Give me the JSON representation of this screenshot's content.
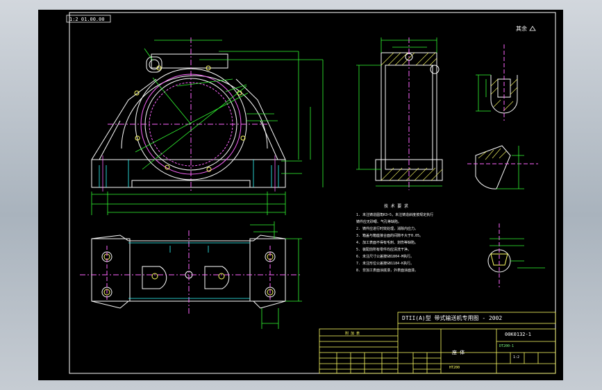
{
  "drawing": {
    "scale_box": "1:2 01.00.00",
    "corner_mark": "其余",
    "tech_title": "技 术 要 求",
    "tech_lines": [
      "1. 未注铸造圆角R3~5，未注铸造斜度按规定执行",
      "   铸件应无砂眼、气孔等缺陷。",
      "2. 铸件应进行时效处理，消除内应力。",
      "3. 箱盖与箱座接合面的间隙不大于0.05。",
      "4. 加工表面不得有毛刺、划伤等缺陷。",
      "5. 装配前所有零件均应清洗干净。",
      "6. 未注尺寸公差按GB1804-M执行。",
      "7. 未注形位公差按GB1184-K执行。",
      "8. 非加工表面涂底漆，外表面涂面漆。"
    ],
    "title_block": {
      "main_title": "DTII(A)型 带式输送机专用图 - 2002",
      "drawing_no": "00K0132-1",
      "part_name": "座 体",
      "material": "HT200",
      "table_header": "附 加 表",
      "scale": "1:2",
      "code": "DT200-1"
    }
  }
}
